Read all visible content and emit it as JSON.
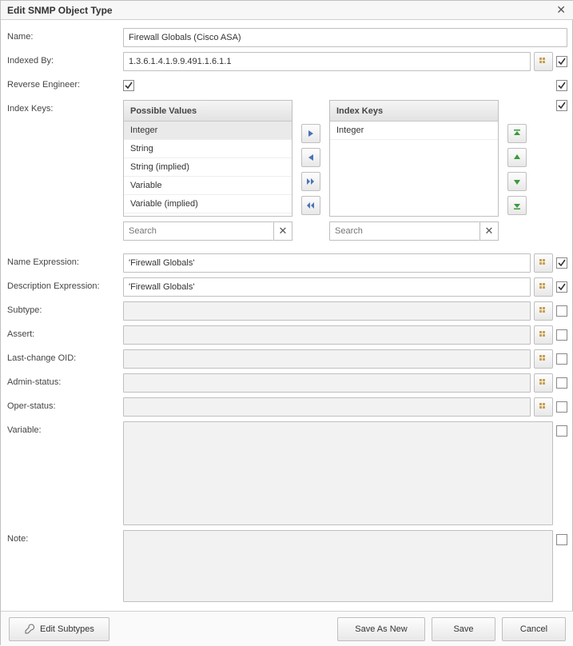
{
  "title": "Edit SNMP Object Type",
  "fields": {
    "name": {
      "label": "Name:",
      "value": "Firewall Globals (Cisco ASA)"
    },
    "indexed_by": {
      "label": "Indexed By:",
      "value": "1.3.6.1.4.1.9.9.491.1.6.1.1",
      "checked": true
    },
    "reverse_engineer": {
      "label": "Reverse Engineer:",
      "checked_left": true,
      "checked_right": true
    },
    "index_keys": {
      "label": "Index Keys:",
      "checked": true
    },
    "name_expression": {
      "label": "Name Expression:",
      "value": "'Firewall Globals'",
      "checked": true
    },
    "description_expression": {
      "label": "Description Expression:",
      "value": "'Firewall Globals'",
      "checked": true
    },
    "subtype": {
      "label": "Subtype:",
      "value": "",
      "checked": false
    },
    "assert": {
      "label": "Assert:",
      "value": "",
      "checked": false
    },
    "last_change_oid": {
      "label": "Last-change OID:",
      "value": "",
      "checked": false
    },
    "admin_status": {
      "label": "Admin-status:",
      "value": "",
      "checked": false
    },
    "oper_status": {
      "label": "Oper-status:",
      "value": "",
      "checked": false
    },
    "variable": {
      "label": "Variable:",
      "value": "",
      "checked": false
    },
    "note": {
      "label": "Note:",
      "value": "",
      "checked": false
    }
  },
  "picker": {
    "possible_header": "Possible Values",
    "keys_header": "Index Keys",
    "possible": [
      "Integer",
      "String",
      "String (implied)",
      "Variable",
      "Variable (implied)"
    ],
    "selected_possible": "Integer",
    "keys": [
      "Integer"
    ],
    "search_placeholder": "Search"
  },
  "buttons": {
    "edit_subtypes": "Edit Subtypes",
    "save_as_new": "Save As New",
    "save": "Save",
    "cancel": "Cancel"
  }
}
